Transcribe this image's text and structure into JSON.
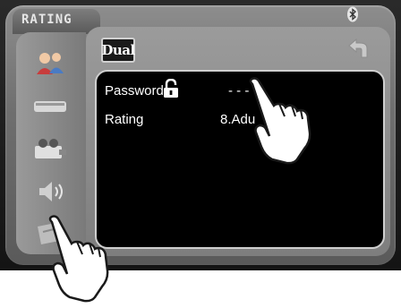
{
  "header": {
    "title": "RATING",
    "brand": "Dual"
  },
  "icons": {
    "status": "bluetooth-icon",
    "back": "back-arrow-icon",
    "lock": "unlocked-padlock-icon"
  },
  "sidebar": {
    "items": [
      {
        "name": "users-icon"
      },
      {
        "name": "device-icon"
      },
      {
        "name": "projector-icon"
      },
      {
        "name": "speaker-icon"
      },
      {
        "name": "rating-icon"
      }
    ]
  },
  "settings": {
    "password_label": "Password",
    "password_value": "- - -",
    "rating_label": "Rating",
    "rating_value": "8.Adu"
  }
}
